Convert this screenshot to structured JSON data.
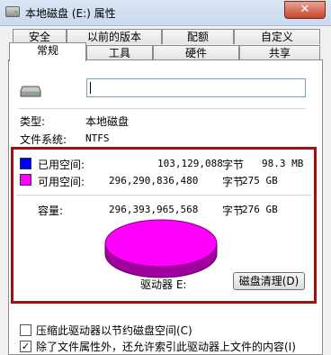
{
  "window": {
    "title": "本地磁盘 (E:) 属性",
    "close_label": "✕"
  },
  "tabs_row1": [
    "安全",
    "以前的版本",
    "配额",
    "自定义"
  ],
  "tabs_row2": [
    "常规",
    "工具",
    "硬件",
    "共享"
  ],
  "general": {
    "name_value": "",
    "type_label": "类型:",
    "type_value": "本地磁盘",
    "fs_label": "文件系统:",
    "fs_value": "NTFS"
  },
  "usage": {
    "used_label": "已用空间:",
    "used_bytes": "103,129,088",
    "used_unit": "字节",
    "used_size": "98.3 MB",
    "used_color": "#0000ff",
    "free_label": "可用空间:",
    "free_bytes": "296,290,836,480",
    "free_unit": "字节",
    "free_size": "275 GB",
    "free_color": "#ff00ff",
    "capacity_label": "容量:",
    "capacity_bytes": "296,393,965,568",
    "capacity_unit": "字节",
    "capacity_size": "276 GB",
    "drive_label": "驱动器 E:",
    "cleanup_button": "磁盘清理(D)"
  },
  "options": {
    "compress_label": "压缩此驱动器以节约磁盘空间(C)",
    "compress_checked": false,
    "index_label": "除了文件属性外，还允许索引此驱动器上文件的内容(I)",
    "index_checked": true,
    "check_mark": "✓"
  }
}
